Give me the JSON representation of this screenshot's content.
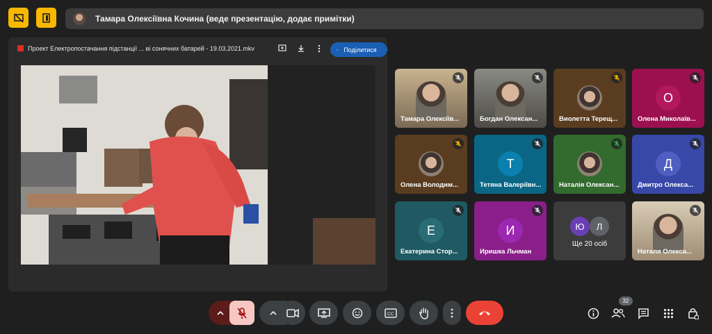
{
  "top": {
    "presenter_title": "Тамара Олексіївна Кочина (веде презентацію, додає примітки)"
  },
  "presentation": {
    "file_name": "Проект Електропостачання підстанції ... ві сонячних батарей - 19.03.2021.mkv",
    "share_label": "Поділитися"
  },
  "participants": [
    {
      "name": "Тамара Олексіїв...",
      "type": "video"
    },
    {
      "name": "Богдан Олексан...",
      "type": "video"
    },
    {
      "name": "Виолетта Терещ...",
      "type": "photo"
    },
    {
      "name": "Олена Миколаїв...",
      "type": "letter",
      "letter": "О"
    },
    {
      "name": "Олена Володим...",
      "type": "photo"
    },
    {
      "name": "Тетяна Валеріївн...",
      "type": "letter",
      "letter": "Т"
    },
    {
      "name": "Наталія Олексан...",
      "type": "photo"
    },
    {
      "name": "Дмитро Олекса...",
      "type": "letter",
      "letter": "Д"
    },
    {
      "name": "Екатерина Стор...",
      "type": "letter",
      "letter": "Е"
    },
    {
      "name": "Иришка Льчман",
      "type": "letter",
      "letter": "И"
    },
    {
      "name": "Ще 20 осіб",
      "type": "more",
      "letters": [
        "Ю",
        "Л"
      ]
    },
    {
      "name": "Наталя Олекса...",
      "type": "video"
    }
  ],
  "people_count": "32",
  "colors": {
    "accent_yellow": "#f9b800",
    "leave_red": "#ea4335",
    "mic_off_bg": "#f6c7c3",
    "share_blue": "#1a5fb4"
  },
  "icons": {
    "top_left_1": "present-off-icon",
    "top_left_2": "door-icon",
    "controls": [
      "chevron-up-icon",
      "mic-off-icon",
      "chevron-up-icon",
      "camera-icon",
      "present-icon",
      "emoji-icon",
      "captions-icon",
      "hand-icon",
      "more-icon",
      "hang-up-icon"
    ],
    "right": [
      "info-icon",
      "people-icon",
      "chat-icon",
      "activities-icon",
      "host-controls-icon"
    ]
  }
}
